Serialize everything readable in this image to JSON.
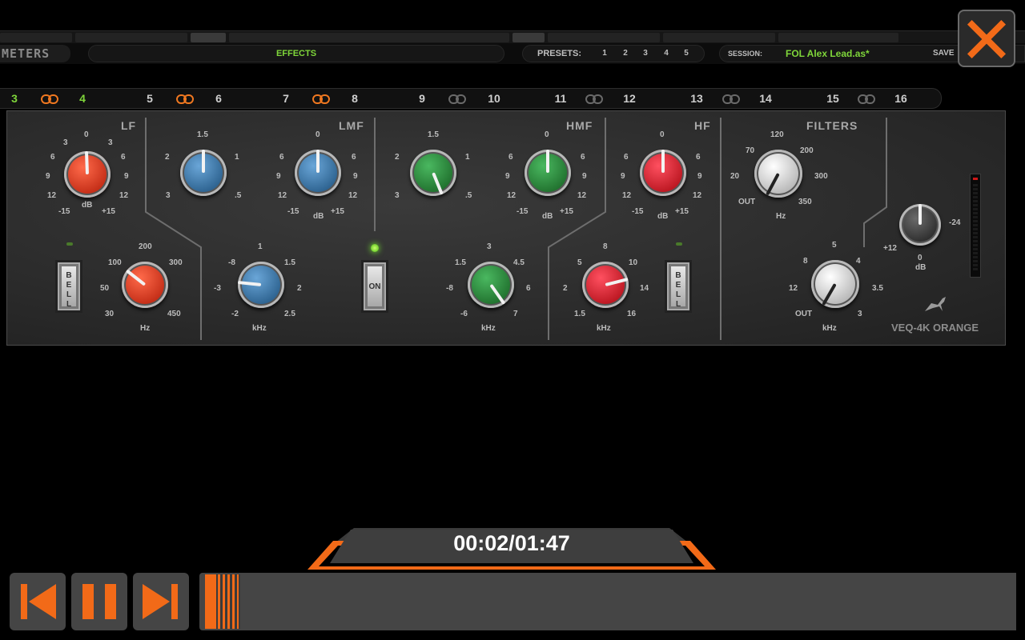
{
  "header": {
    "meters_label": "METERS",
    "effects_label": "EFFECTS",
    "presets_label": "PRESETS:",
    "presets": [
      "1",
      "2",
      "3",
      "4",
      "5"
    ],
    "session_label": "SESSION:",
    "session_value": "FOL Alex Lead.as*",
    "save_label": "SAVE"
  },
  "channels": [
    {
      "num": "3",
      "active": true
    },
    {
      "num": "4",
      "active": true
    },
    {
      "num": "5",
      "active": false
    },
    {
      "num": "6",
      "active": false
    },
    {
      "num": "7",
      "active": false
    },
    {
      "num": "8",
      "active": false
    },
    {
      "num": "9",
      "active": false
    },
    {
      "num": "10",
      "active": false
    },
    {
      "num": "11",
      "active": false
    },
    {
      "num": "12",
      "active": false
    },
    {
      "num": "13",
      "active": false
    },
    {
      "num": "14",
      "active": false
    },
    {
      "num": "15",
      "active": false
    },
    {
      "num": "16",
      "active": false
    }
  ],
  "links_on": [
    true,
    true,
    true,
    false,
    false,
    false,
    false
  ],
  "eq": {
    "sections": {
      "lf": "LF",
      "lmf": "LMF",
      "hmf": "HMF",
      "hf": "HF",
      "filters": "FILTERS"
    },
    "brand": "VEQ-4K ORANGE",
    "bell_label": "BELL",
    "on_label": "ON",
    "units": {
      "db": "dB",
      "hz": "Hz",
      "khz": "kHz"
    },
    "gain_scale": [
      "-15",
      "12",
      "9",
      "6",
      "3",
      "0",
      "3",
      "6",
      "9",
      "12",
      "+15"
    ],
    "lmf_q_scale": [
      "3",
      "2",
      "1.5",
      "1",
      ".5"
    ],
    "lf_freq_scale": [
      "30",
      "50",
      "100",
      "200",
      "300",
      "450"
    ],
    "lmf_freq_scale": [
      "-2",
      "-3",
      "-8",
      "1",
      "1.5",
      "2",
      "2.5"
    ],
    "hmf_freq_scale": [
      "-6",
      "-8",
      "1.5",
      "3",
      "4.5",
      "6",
      "7"
    ],
    "hf_freq_scale": [
      "1.5",
      "2",
      "5",
      "8",
      "10",
      "14",
      "16"
    ],
    "hpf_scale": [
      "OUT",
      "20",
      "70",
      "120",
      "200",
      "300",
      "350"
    ],
    "lpf_scale": [
      "OUT",
      "12",
      "8",
      "5",
      "4",
      "3.5",
      "3"
    ],
    "out_scale": [
      "+12",
      "0",
      "-24"
    ]
  },
  "player": {
    "time": "00:02/01:47",
    "progress": 0.02
  },
  "colors": {
    "accent": "#f26a18",
    "green": "#7fd63a"
  }
}
